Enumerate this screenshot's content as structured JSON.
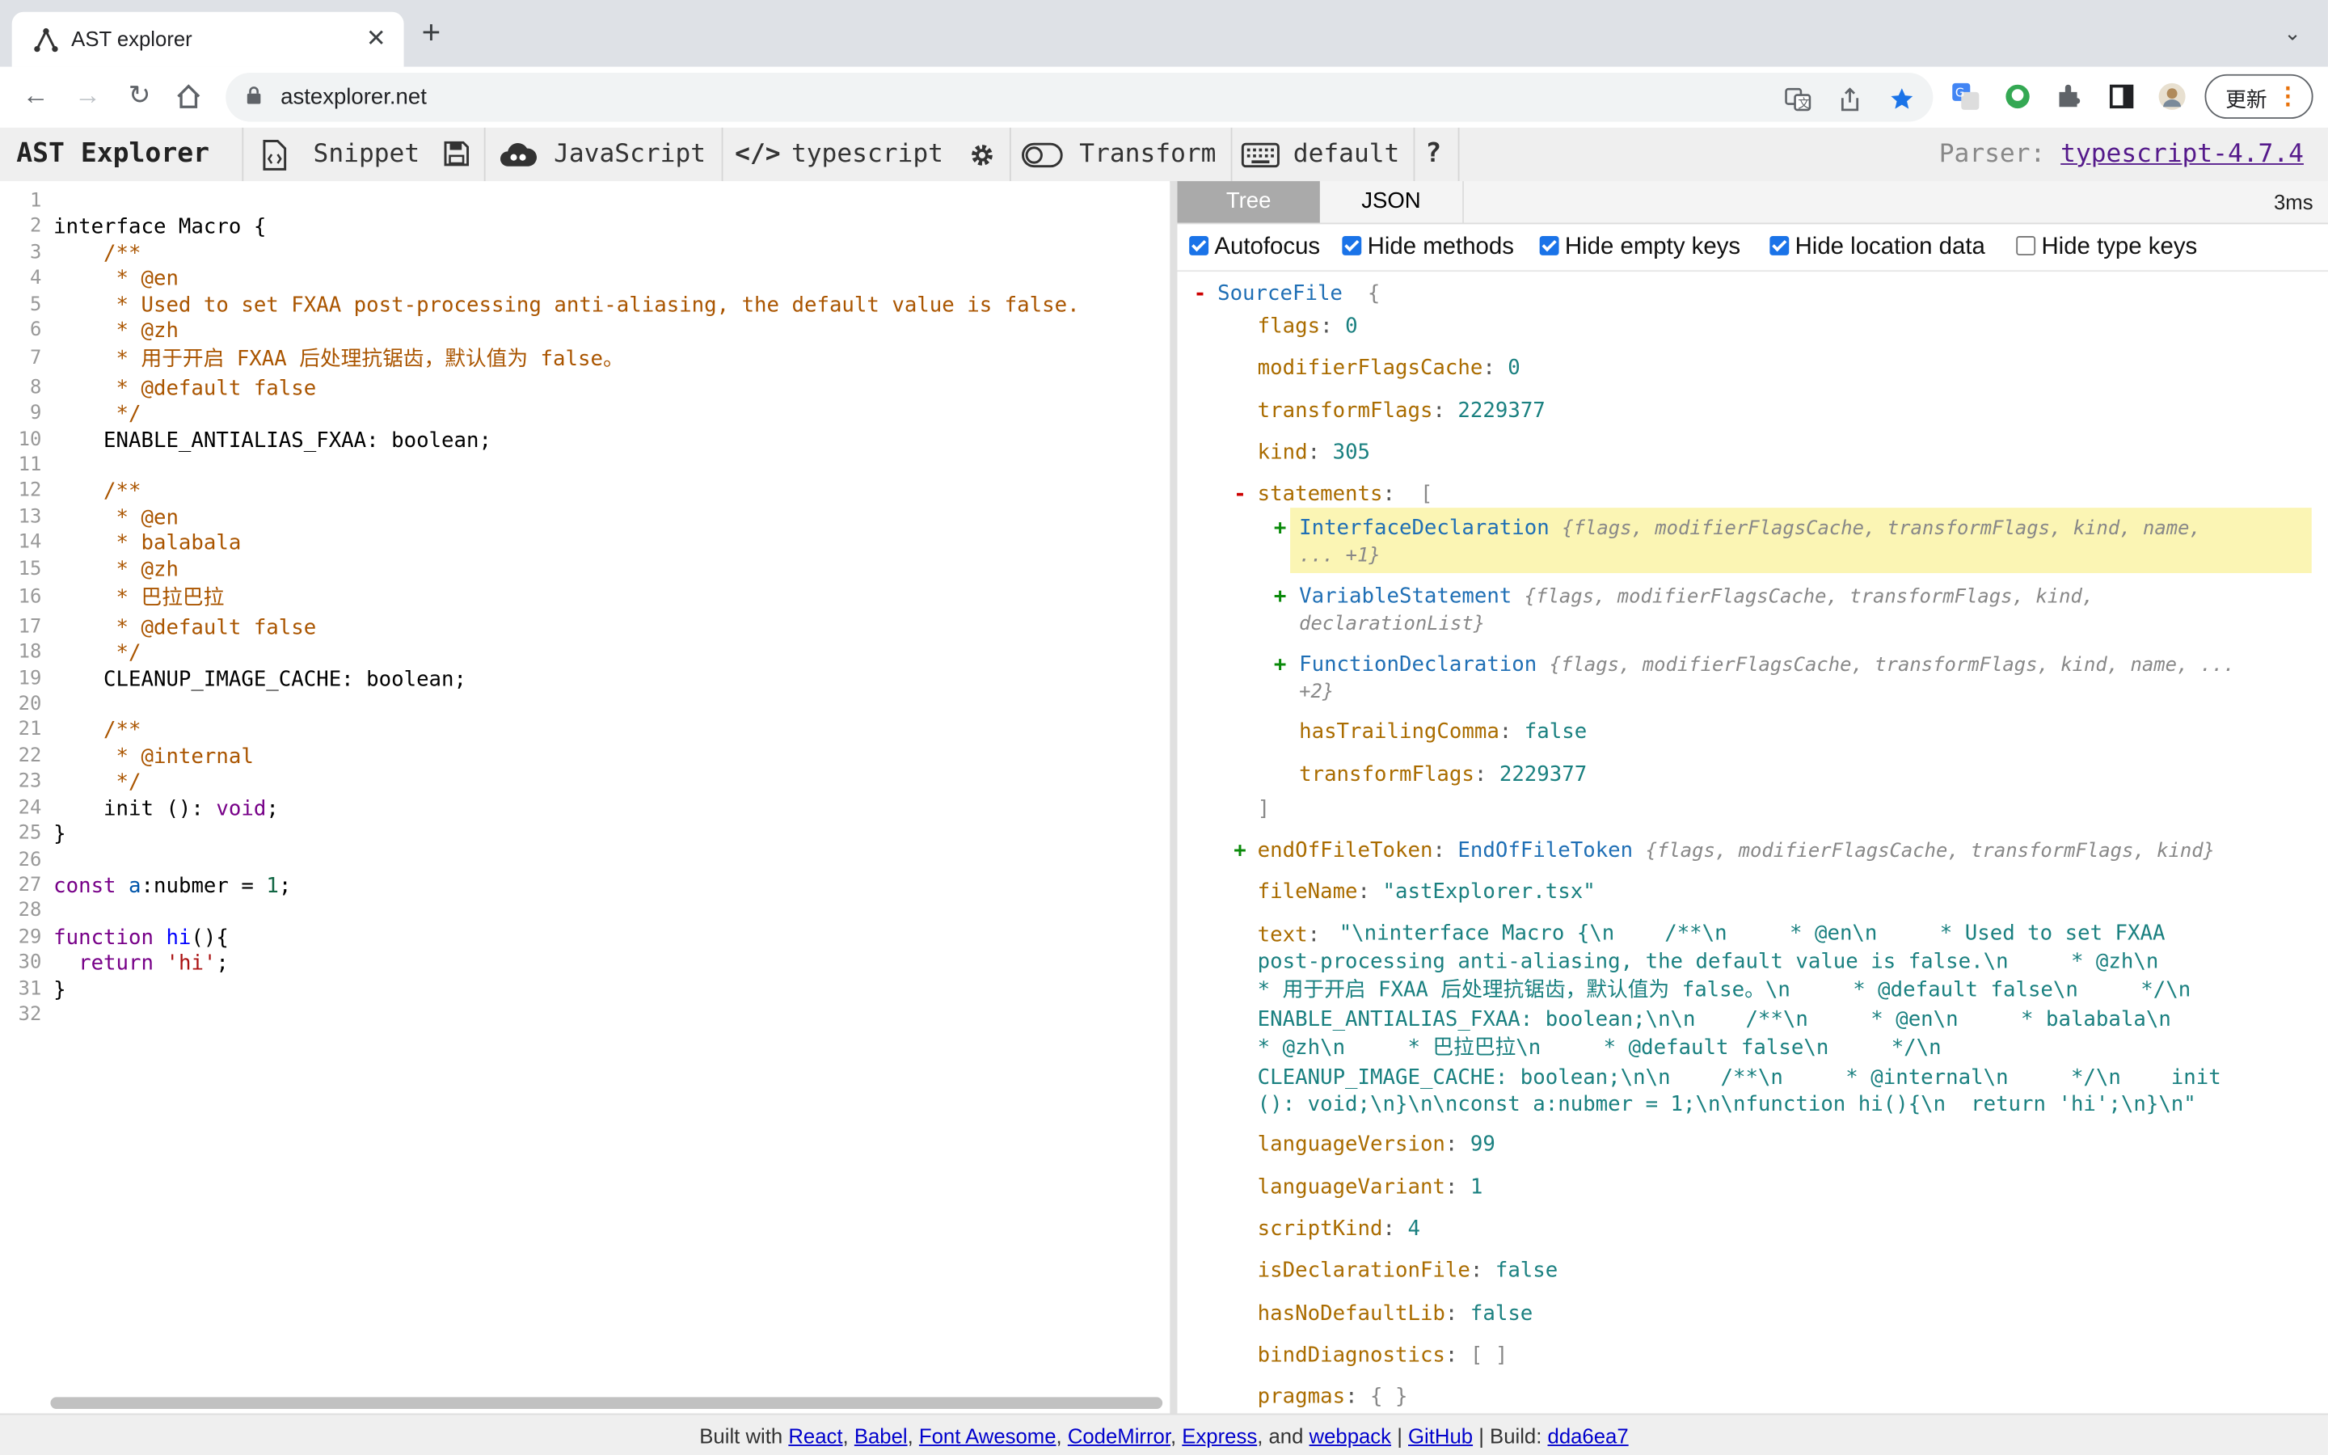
{
  "browser": {
    "tab_title": "AST explorer",
    "url": "astexplorer.net",
    "update_label": "更新"
  },
  "toolbar": {
    "brand": "AST Explorer",
    "snippet": "Snippet",
    "language": "JavaScript",
    "parser_name": "typescript",
    "transform": "Transform",
    "keymap": "default",
    "help": "?",
    "parser_label": "Parser:",
    "parser_version": "typescript-4.7.4"
  },
  "editor": {
    "line_numbers": [
      "1",
      "2",
      "3",
      "4",
      "5",
      "6",
      "7",
      "8",
      "9",
      "10",
      "11",
      "12",
      "13",
      "14",
      "15",
      "16",
      "17",
      "18",
      "19",
      "20",
      "21",
      "22",
      "23",
      "24",
      "25",
      "26",
      "27",
      "28",
      "29",
      "30",
      "31",
      "32"
    ],
    "lines": {
      "l2": "interface Macro {",
      "l3": "    /**",
      "l4": "     * @en",
      "l5": "     * Used to set FXAA post-processing anti-aliasing, the default value is false.",
      "l6": "     * @zh",
      "l7": "     * 用于开启 FXAA 后处理抗锯齿，默认值为 false。",
      "l8": "     * @default false",
      "l9": "     */",
      "l10": "    ENABLE_ANTIALIAS_FXAA: boolean;",
      "l12": "    /**",
      "l13": "     * @en",
      "l14": "     * balabala",
      "l15": "     * @zh",
      "l16": "     * 巴拉巴拉",
      "l17": "     * @default false",
      "l18": "     */",
      "l19": "    CLEANUP_IMAGE_CACHE: boolean;",
      "l21": "    /**",
      "l22": "     * @internal",
      "l23": "     */",
      "l24a": "    init (): ",
      "l24b": "void",
      "l24c": ";",
      "l25": "}",
      "l27a": "const ",
      "l27b": "a",
      "l27c": ":nubmer = ",
      "l27d": "1",
      "l27e": ";",
      "l29a": "function ",
      "l29b": "hi",
      "l29c": "(){",
      "l30a": "  ",
      "l30b": "return",
      "l30c": " ",
      "l30d": "'hi'",
      "l30e": ";",
      "l31": "}"
    }
  },
  "output": {
    "tabs": [
      "Tree",
      "JSON"
    ],
    "timing": "3ms",
    "options": [
      {
        "label": "Autofocus",
        "checked": true
      },
      {
        "label": "Hide methods",
        "checked": true
      },
      {
        "label": "Hide empty keys",
        "checked": true
      },
      {
        "label": "Hide location data",
        "checked": true
      },
      {
        "label": "Hide type keys",
        "checked": false
      }
    ],
    "tree": {
      "root_type": "SourceFile",
      "flags": "0",
      "modifierFlagsCache": "0",
      "transformFlags": "2229377",
      "kind": "305",
      "statements_key": "statements",
      "stmt1_type": "InterfaceDeclaration",
      "stmt1_summary_a": "{flags, modifierFlagsCache, transformFlags, kind, name,",
      "stmt1_summary_b": "... +1}",
      "stmt2_type": "VariableStatement",
      "stmt2_summary_a": "{flags, modifierFlagsCache, transformFlags, kind,",
      "stmt2_summary_b": "declarationList}",
      "stmt3_type": "FunctionDeclaration",
      "stmt3_summary_a": "{flags, modifierFlagsCache, transformFlags, kind, name, ...",
      "stmt3_summary_b": "+2}",
      "hasTrailingComma": "false",
      "stmt_transformFlags": "2229377",
      "eof_key": "endOfFileToken",
      "eof_type": "EndOfFileToken",
      "eof_summary": "{flags, modifierFlagsCache, transformFlags, kind}",
      "fileName": "\"astExplorer.tsx\"",
      "text_lines": [
        "\"\\ninterface Macro {\\n    /**\\n     * @en\\n     * Used to set FXAA",
        "post-processing anti-aliasing, the default value is false.\\n     * @zh\\n",
        "* 用于开启 FXAA 后处理抗锯齿，默认值为 false。\\n     * @default false\\n     */\\n",
        "ENABLE_ANTIALIAS_FXAA: boolean;\\n\\n    /**\\n     * @en\\n     * balabala\\n",
        "* @zh\\n     * 巴拉巴拉\\n     * @default false\\n     */\\n",
        "CLEANUP_IMAGE_CACHE: boolean;\\n\\n    /**\\n     * @internal\\n     */\\n    init",
        "(): void;\\n}\\n\\nconst a:nubmer = 1;\\n\\nfunction hi(){\\n  return 'hi';\\n}\\n\""
      ],
      "languageVersion": "99",
      "languageVariant": "1",
      "scriptKind": "4",
      "isDeclarationFile": "false",
      "hasNoDefaultLib": "false",
      "bindDiagnostics": "[ ]",
      "pragmas": "{ }"
    }
  },
  "footer": {
    "built_with": "Built with",
    "react": "React",
    "babel": "Babel",
    "fontawesome": "Font Awesome",
    "codemirror": "CodeMirror",
    "express": "Express",
    "and": ", and",
    "webpack": "webpack",
    "github": "GitHub",
    "build_label": "Build:",
    "build_hash": "dda6ea7"
  },
  "colors": {
    "accent": "#1a73e8",
    "comment": "#aa5500",
    "keyword": "#770088",
    "highlight": "#fbf5b4"
  }
}
